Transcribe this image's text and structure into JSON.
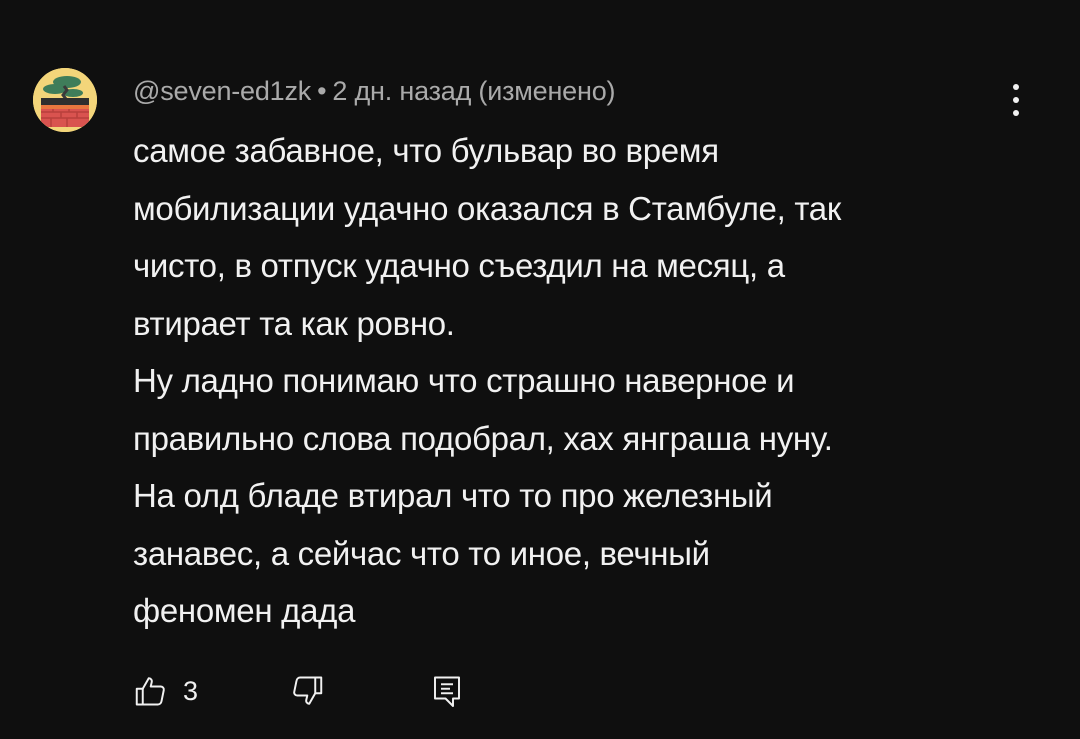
{
  "comment": {
    "author_handle": "@seven-ed1zk",
    "separator": "•",
    "timestamp": "2 дн. назад (изменено)",
    "text_lines": [
      "самое забавное, что бульвар во время",
      "мобилизации удачно оказался в Стамбуле, так",
      "чисто, в отпуск удачно съездил на месяц, а",
      "втирает та как ровно.",
      "Ну ладно понимаю что страшно наверное и",
      "правильно слова подобрал, хах янграша нуну.",
      "На олд бладе втирал что то про железный",
      "занавес, а сейчас что то иное, вечный",
      "феномен дада"
    ],
    "like_count": "3",
    "icons": {
      "menu": "more-vert-icon",
      "like": "thumbs-up-icon",
      "dislike": "thumbs-down-icon",
      "reply": "reply-icon"
    }
  },
  "colors": {
    "background": "#0f0f0f",
    "primary_text": "#f1f1f1",
    "secondary_text": "#aaaaaa",
    "avatar_bg": "#f3d57a"
  }
}
